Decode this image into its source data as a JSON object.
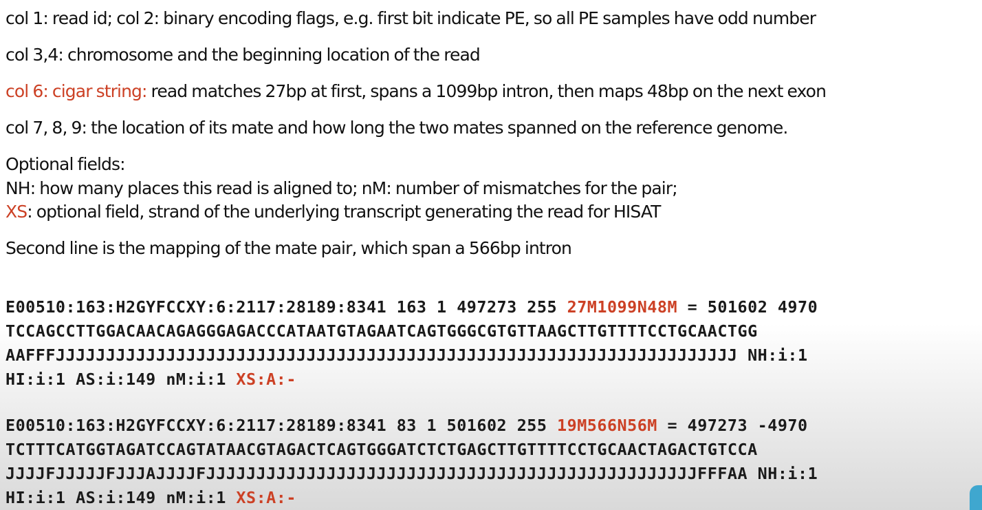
{
  "notes": {
    "col1": "col 1: read id; col 2: binary encoding flags, e.g. first bit indicate PE, so all PE samples have odd number",
    "col34": "col 3,4: chromosome and the beginning location of the read",
    "col6_label": "col 6: cigar string:",
    "col6_text": " read matches 27bp at first, spans a 1099bp intron, then maps 48bp on the next exon",
    "col789": "col 7, 8, 9: the location of its mate and how long the two mates spanned on the reference genome.",
    "optional_title": "Optional fields:",
    "nh_nm": "NH: how many places this read is aligned to;  nM: number of mismatches for the pair;",
    "xs_label": "XS",
    "xs_text": ": optional field, strand of the underlying transcript generating the read for HISAT",
    "second_line": "Second line is the mapping of the mate pair, which span a 566bp intron"
  },
  "records": [
    {
      "prefix": "E00510:163:H2GYFCCXY:6:2117:28189:8341 163 1 497273 255 ",
      "cigar": "27M1099N48M",
      "mate": " = 501602 4970",
      "sequence": "TCCAGCCTTGGACAACAGAGGGAGACCCATAATGTAGAATCAGTGGGCGTGTTAAGCTTGTTTTCCTGCAACTGG",
      "quality": "AAFFFJJJJJJJJJJJJJJJJJJJJJJJJJJJJJJJJJJJJJJJJJJJJJJJJJJJJJJJJJJJJJJJJJJJJ NH:i:1",
      "tags": "HI:i:1 AS:i:149 nM:i:1 ",
      "xs": "XS:A:-"
    },
    {
      "prefix": "E00510:163:H2GYFCCXY:6:2117:28189:8341 83 1 501602 255 ",
      "cigar": "19M566N56M",
      "mate": " = 497273 -4970",
      "sequence": "TCTTTCATGGTAGATCCAGTATAACGTAGACTCAGTGGGATCTCTGAGCTTGTTTTCCTGCAACTAGACTGTCCA",
      "quality": "JJJJFJJJJJFJJJAJJJJFJJJJJJJJJJJJJJJJJJJJJJJJJJJJJJJJJJJJJJJJJJJJJJJJJFFFAA NH:i:1",
      "tags": "HI:i:1 AS:i:149 nM:i:1 ",
      "xs": "XS:A:-"
    }
  ],
  "colors": {
    "accent": "#cc4125",
    "text": "#111111",
    "tab": "#3fa7cf"
  }
}
